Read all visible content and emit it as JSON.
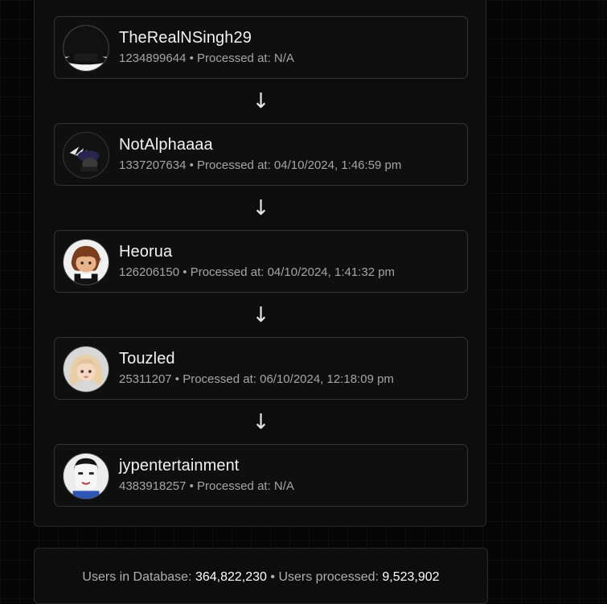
{
  "users": [
    {
      "name": "TheRealNSingh29",
      "id": "1234899644",
      "processed_label": "Processed at:",
      "processed_at": "N/A",
      "avatar_icon": "avatar-black-hat-icon"
    },
    {
      "name": "NotAlphaaaa",
      "id": "1337207634",
      "processed_label": "Processed at:",
      "processed_at": "04/10/2024, 1:46:59 pm",
      "avatar_icon": "avatar-feather-hat-icon"
    },
    {
      "name": "Heorua",
      "id": "126206150",
      "processed_label": "Processed at:",
      "processed_at": "04/10/2024, 1:41:32 pm",
      "avatar_icon": "avatar-brown-hair-icon"
    },
    {
      "name": "Touzled",
      "id": "25311207",
      "processed_label": "Processed at:",
      "processed_at": "06/10/2024, 12:18:09 pm",
      "avatar_icon": "avatar-blonde-hair-icon"
    },
    {
      "name": "jypentertainment",
      "id": "4383918257",
      "processed_label": "Processed at:",
      "processed_at": "N/A",
      "avatar_icon": "avatar-white-face-icon"
    }
  ],
  "arrow_glyph": "↓",
  "stats": {
    "db_label": "Users in Database:",
    "db_count": "364,822,230",
    "separator": "•",
    "processed_label": "Users processed:",
    "processed_count": "9,523,902"
  }
}
